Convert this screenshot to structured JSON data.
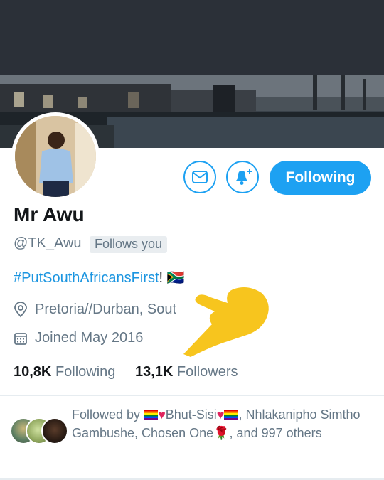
{
  "profile": {
    "display_name": "Mr Awu",
    "handle": "@TK_Awu",
    "follows_you_label": "Follows you",
    "bio_hashtag": "#PutSouthAfricansFirst",
    "bio_suffix": "!",
    "bio_flag": "🇿🇦",
    "location": "Pretoria//Durban, Sout",
    "joined": "Joined May 2016"
  },
  "actions": {
    "following_label": "Following"
  },
  "stats": {
    "following_count": "10,8K",
    "following_label": "Following",
    "followers_count": "13,1K",
    "followers_label": "Followers"
  },
  "followed_by": {
    "prefix": "Followed by ",
    "name1": "Bhut-Sisi",
    "sep1": ", Nhlakanipho Simtho Gambushe, Chosen One",
    "suffix": ", and 997 others"
  },
  "icons": {
    "message": "envelope-icon",
    "notifications": "bell-plus-icon",
    "location": "map-pin-icon",
    "calendar": "calendar-icon",
    "rose": "rose-icon"
  },
  "colors": {
    "accent": "#1da1f2",
    "hashtag": "#1b95e0",
    "muted": "#657786",
    "overlay_hand": "#f7c51e"
  }
}
